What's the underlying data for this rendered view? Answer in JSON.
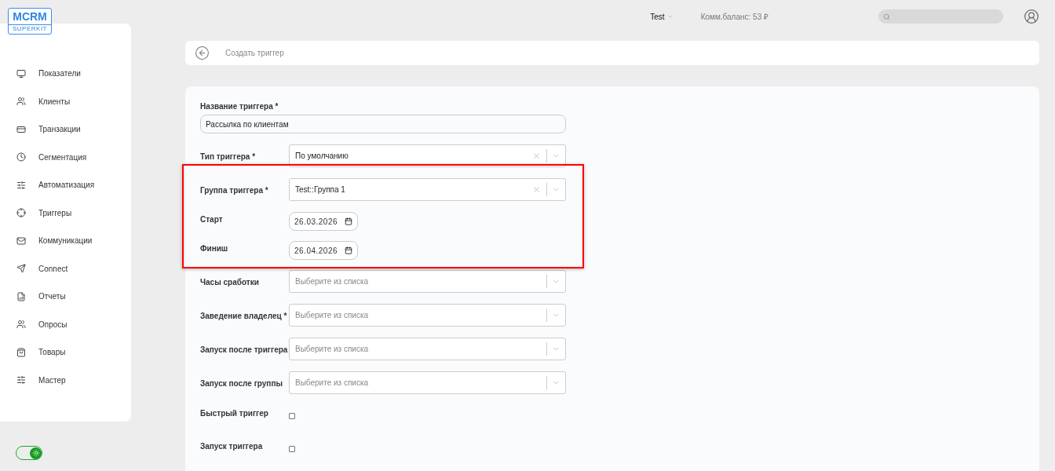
{
  "logo": {
    "title": "MCRM",
    "subtitle": "SUPERKIT"
  },
  "sidebar": {
    "items": [
      {
        "label": "Показатели"
      },
      {
        "label": "Клиенты"
      },
      {
        "label": "Транзакции"
      },
      {
        "label": "Сегментация"
      },
      {
        "label": "Автоматизация"
      },
      {
        "label": "Триггеры"
      },
      {
        "label": "Коммуникации"
      },
      {
        "label": "Connect"
      },
      {
        "label": "Отчеты"
      },
      {
        "label": "Опросы"
      },
      {
        "label": "Товары"
      },
      {
        "label": "Мастер"
      }
    ]
  },
  "theme_toggle": {
    "on": true
  },
  "topbar": {
    "account": "Test",
    "balance": "Комм.баланс: 53 ₽"
  },
  "header": {
    "title": "Создать триггер"
  },
  "form": {
    "fields": [
      {
        "kind": "text",
        "label": "Название триггера *",
        "value": "Рассылка по клиентам"
      },
      {
        "kind": "select",
        "label": "Тип триггера *",
        "value": "По умолчанию",
        "clearable": true
      },
      {
        "kind": "select",
        "label": "Группа триггера *",
        "value": "Test::Группа 1",
        "clearable": true
      },
      {
        "kind": "date",
        "label": "Старт",
        "value": "26.03.2026"
      },
      {
        "kind": "date",
        "label": "Финиш",
        "value": "26.04.2026"
      },
      {
        "kind": "select",
        "label": "Часы сработки",
        "placeholder": "Выберите из списка",
        "clearable": false
      },
      {
        "kind": "select",
        "label": "Заведение владелец *",
        "placeholder": "Выберите из списка",
        "clearable": false
      },
      {
        "kind": "select",
        "label": "Запуск после триггера",
        "placeholder": "Выберите из списка",
        "clearable": false
      },
      {
        "kind": "select",
        "label": "Запуск после группы",
        "placeholder": "Выберите из списка",
        "clearable": false
      },
      {
        "kind": "checkbox",
        "label": "Быстрый триггер",
        "checked": false
      },
      {
        "kind": "checkbox",
        "label": "Запуск триггера",
        "checked": false
      }
    ]
  }
}
